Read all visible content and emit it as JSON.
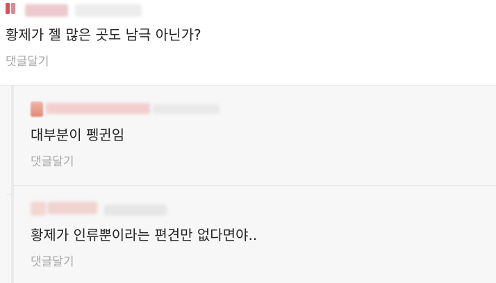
{
  "comments": [
    {
      "text": "황제가 젤 많은 곳도 남극 아닌가?",
      "reply_label": "댓글달기"
    }
  ],
  "replies": [
    {
      "text": "대부분이 펭귄임",
      "reply_label": "댓글달기"
    },
    {
      "text": "황제가 인류뿐이라는 편견만 없다면야..",
      "reply_label": "댓글달기"
    }
  ],
  "colors": {
    "text": "#222222",
    "reply_link": "#a8a8a8",
    "reply_background": "#f7f7f7",
    "divider": "#e4e4e4"
  }
}
